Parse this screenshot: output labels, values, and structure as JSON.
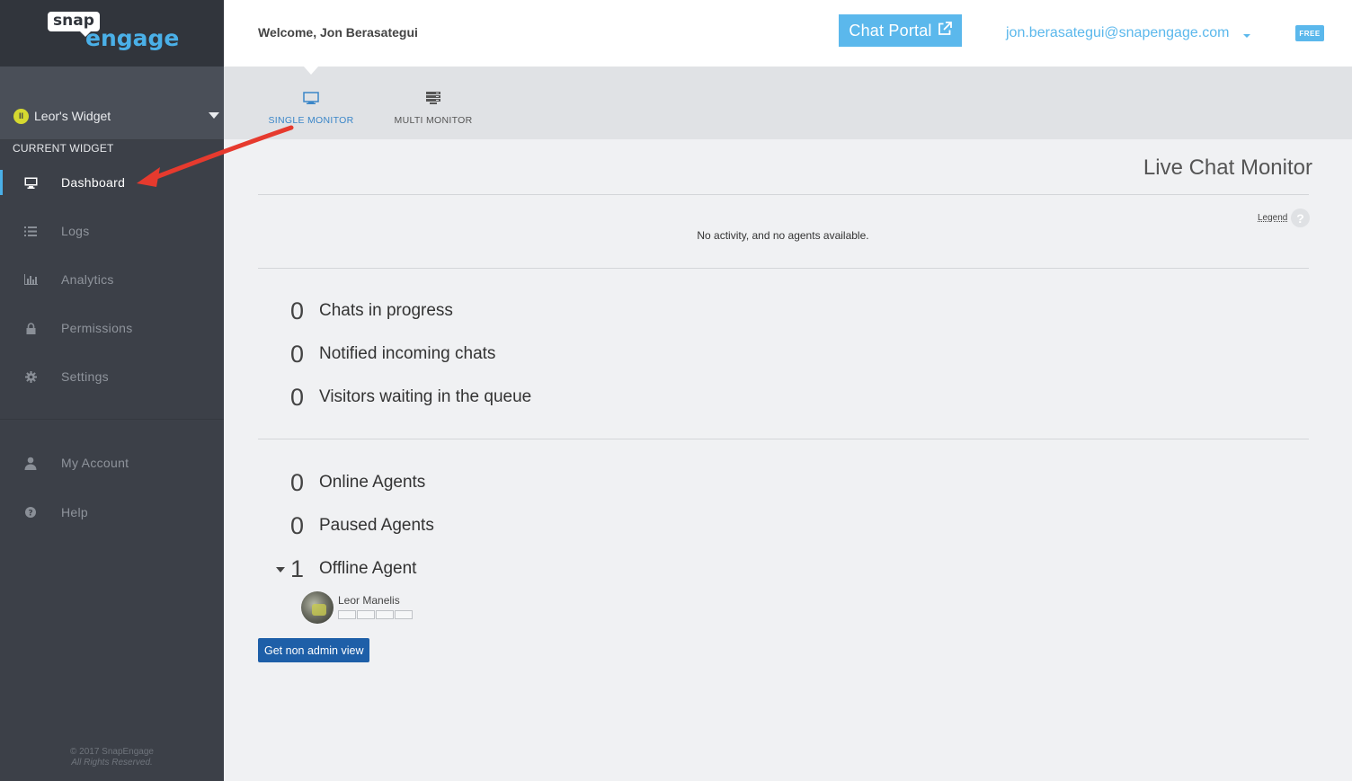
{
  "brand": {
    "logo_snap": "snap",
    "logo_engage": "engage",
    "accent": "#4ab0e8"
  },
  "sidebar": {
    "current_widget_label": "CURRENT WIDGET",
    "widget_name": "Leor's Widget",
    "widget_badge": "II",
    "items": [
      {
        "label": "Dashboard",
        "icon": "monitor-icon",
        "active": true
      },
      {
        "label": "Logs",
        "icon": "list-icon",
        "active": false
      },
      {
        "label": "Analytics",
        "icon": "bar-chart-icon",
        "active": false
      },
      {
        "label": "Permissions",
        "icon": "lock-icon",
        "active": false
      },
      {
        "label": "Settings",
        "icon": "gear-icon",
        "active": false
      },
      {
        "label": "My Account",
        "icon": "user-icon",
        "active": false
      },
      {
        "label": "Help",
        "icon": "question-icon",
        "active": false
      }
    ],
    "copyright_line1": "© 2017 SnapEngage",
    "copyright_line2": "All Rights Reserved."
  },
  "header": {
    "welcome": "Welcome, Jon Berasategui",
    "chat_portal": "Chat Portal",
    "user_email": "jon.berasategui@snapengage.com",
    "plan_badge": "FREE"
  },
  "tabs": [
    {
      "label": "SINGLE MONITOR",
      "icon": "monitor-icon",
      "active": true
    },
    {
      "label": "MULTI MONITOR",
      "icon": "multi-monitor-icon",
      "active": false
    }
  ],
  "main": {
    "title": "Live Chat Monitor",
    "legend": "Legend",
    "legend_icon": "?",
    "no_activity": "No activity, and no agents available.",
    "chat_stats": [
      {
        "count": "0",
        "label": "Chats in progress"
      },
      {
        "count": "0",
        "label": "Notified incoming chats"
      },
      {
        "count": "0",
        "label": "Visitors waiting in the queue"
      }
    ],
    "agent_stats": [
      {
        "count": "0",
        "label": "Online Agents"
      },
      {
        "count": "0",
        "label": "Paused Agents"
      },
      {
        "count": "1",
        "label": "Offline Agent"
      }
    ],
    "offline_agents": [
      {
        "name": "Leor Manelis",
        "slots": 4
      }
    ],
    "non_admin_button": "Get non admin view"
  }
}
